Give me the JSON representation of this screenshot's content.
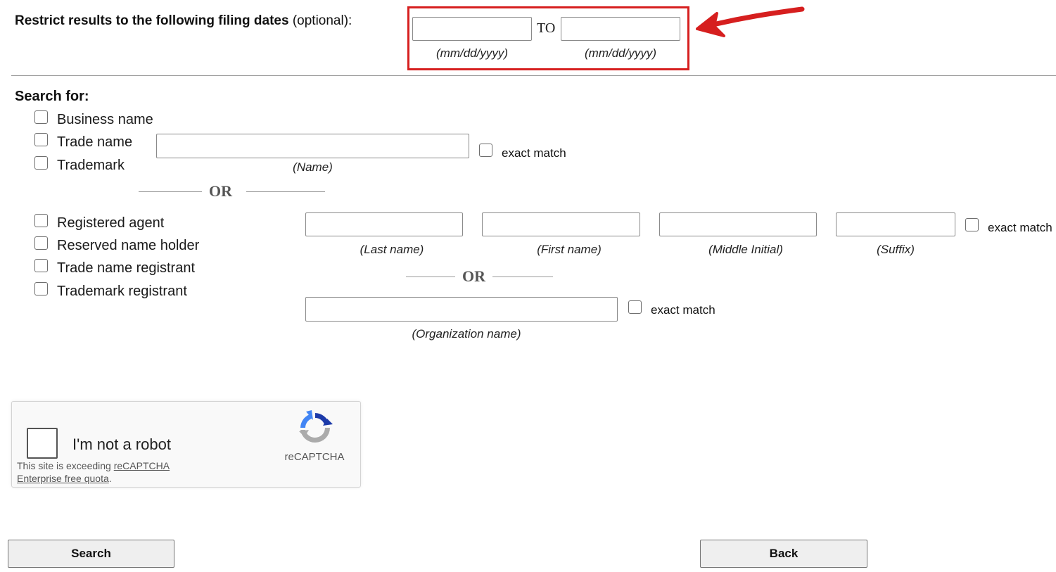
{
  "filing_dates": {
    "label_bold": "Restrict results to the following filing dates",
    "label_optional": "(optional):",
    "from_value": "",
    "to_value": "",
    "to_label": "TO",
    "from_hint": "(mm/dd/yyyy)",
    "to_hint": "(mm/dd/yyyy)",
    "highlight_color": "#d61f1f"
  },
  "search_for": {
    "heading": "Search for:",
    "name_types": [
      "Business name",
      "Trade name",
      "Trademark"
    ],
    "name_value": "",
    "name_hint": "(Name)",
    "exact_match_label": "exact match",
    "or_label": "OR",
    "person_types": [
      "Registered agent",
      "Reserved name holder",
      "Trade name registrant",
      "Trademark registrant"
    ],
    "person_fields": {
      "last_hint": "(Last name)",
      "first_hint": "(First name)",
      "middle_hint": "(Middle Initial)",
      "suffix_hint": "(Suffix)"
    },
    "person_exact_match_label": "exact match",
    "or_label_2": "OR",
    "org_value": "",
    "org_hint": "(Organization name)",
    "org_exact_match_label": "exact match"
  },
  "captcha": {
    "label": "I'm not a robot",
    "note_prefix": "This site is exceeding ",
    "note_link": "reCAPTCHA Enterprise free quota",
    "note_suffix": ".",
    "brand": "reCAPTCHA",
    "icon": "recaptcha-logo-icon"
  },
  "buttons": {
    "search": "Search",
    "back": "Back"
  },
  "annotation": {
    "arrow_icon": "red-arrow-icon",
    "color": "#d61f1f"
  }
}
